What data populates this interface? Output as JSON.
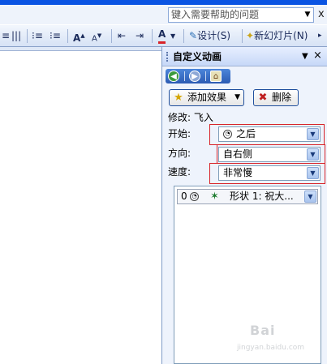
{
  "menu": {
    "help_placeholder": "键入需要帮助的问题",
    "close_glyph": "x"
  },
  "toolbar": {
    "font_grow": "A",
    "font_shrink": "A",
    "font_color": "A",
    "design_label": "设计(S)",
    "new_slide_label": "新幻灯片(N)"
  },
  "task_pane": {
    "title": "自定义动画",
    "add_effect_label": "添加效果",
    "remove_label": "删除",
    "modify_label": "修改: 飞入",
    "start_label": "开始:",
    "start_value": "之后",
    "direction_label": "方向:",
    "direction_value": "自右侧",
    "speed_label": "速度:",
    "speed_value": "非常慢",
    "animation_items": [
      {
        "order": "0",
        "label": "形状 1: 祝大..."
      }
    ]
  },
  "watermark": {
    "text": "Bai",
    "subtext": "jingyan.baidu.com"
  },
  "icons": {
    "nav_back": "back-arrow-icon",
    "nav_forward": "forward-arrow-icon",
    "nav_home": "home-icon",
    "start_clock": "clock-icon",
    "effect_star": "star-effect-icon"
  }
}
